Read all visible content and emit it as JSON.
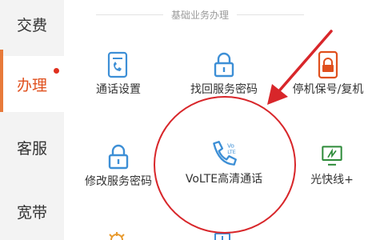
{
  "sidebar": {
    "items": [
      {
        "label": "交费"
      },
      {
        "label": "办理"
      },
      {
        "label": "客服"
      },
      {
        "label": "宽带"
      }
    ]
  },
  "section": {
    "title": "基础业务办理"
  },
  "tiles": [
    {
      "label": "通话设置",
      "icon": "phone-document-icon"
    },
    {
      "label": "找回服务密码",
      "icon": "lock-icon"
    },
    {
      "label": "停机保号/复机",
      "icon": "phone-lock-icon"
    },
    {
      "label": "修改服务密码",
      "icon": "lock-icon"
    },
    {
      "label": "VoLTE高清通话",
      "icon": "volte-phone-icon"
    },
    {
      "label": "光快线+",
      "icon": "monitor-icon"
    }
  ],
  "icons": {
    "volte_text_top": "Vo",
    "volte_text_bottom": "LTE"
  },
  "colors": {
    "accent": "#e0501e",
    "icon_blue": "#3d8fd6",
    "annotation_red": "#d8262a",
    "icon_green": "#2e8b3a"
  }
}
